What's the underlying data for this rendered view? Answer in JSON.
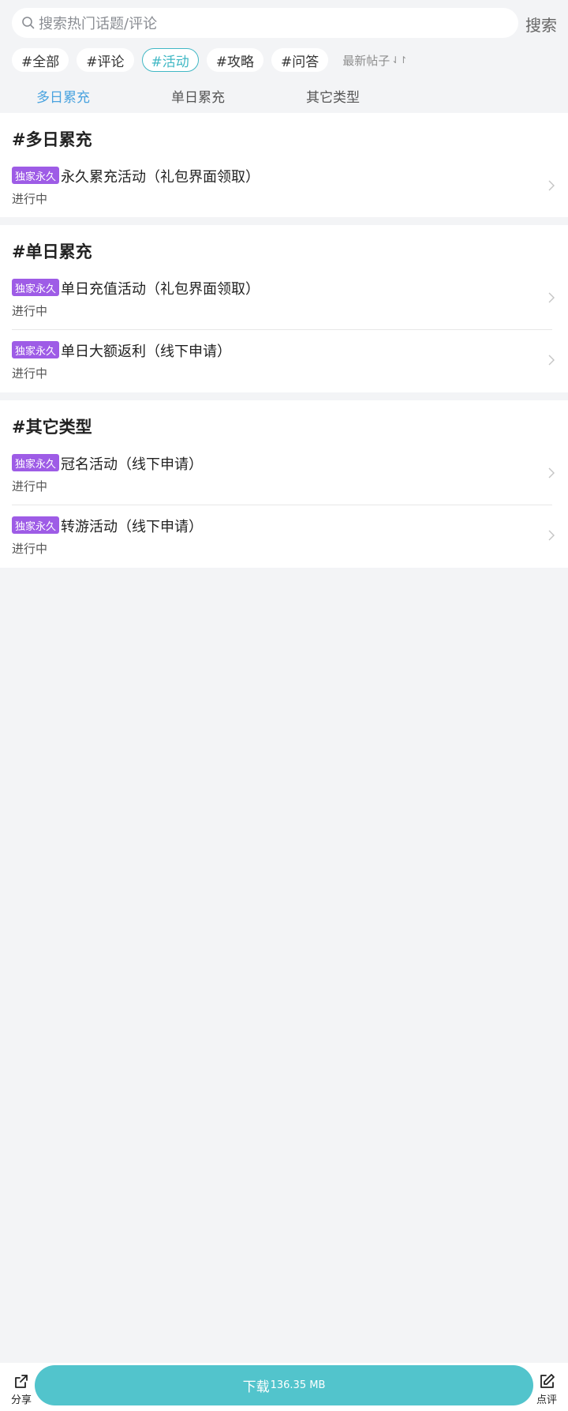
{
  "search": {
    "placeholder": "搜索热门话题/评论",
    "button_label": "搜索"
  },
  "tags": [
    {
      "label": "#全部",
      "active": false
    },
    {
      "label": "#评论",
      "active": false
    },
    {
      "label": "#活动",
      "active": true
    },
    {
      "label": "#攻略",
      "active": false
    },
    {
      "label": "#问答",
      "active": false
    }
  ],
  "sort": {
    "label": "最新帖子",
    "icon": "sort-arrows-icon"
  },
  "category_tabs": [
    {
      "label": "多日累充",
      "active": true
    },
    {
      "label": "单日累充",
      "active": false
    },
    {
      "label": "其它类型",
      "active": false
    }
  ],
  "sections": [
    {
      "title": "#多日累充",
      "items": [
        {
          "badge": "独家永久",
          "title": "永久累充活动（礼包界面领取）",
          "status": "进行中"
        }
      ]
    },
    {
      "title": "#单日累充",
      "items": [
        {
          "badge": "独家永久",
          "title": "单日充值活动（礼包界面领取）",
          "status": "进行中"
        },
        {
          "badge": "独家永久",
          "title": "单日大额返利（线下申请）",
          "status": "进行中"
        }
      ]
    },
    {
      "title": "#其它类型",
      "items": [
        {
          "badge": "独家永久",
          "title": "冠名活动（线下申请）",
          "status": "进行中"
        },
        {
          "badge": "独家永久",
          "title": "转游活动（线下申请）",
          "status": "进行中"
        }
      ]
    }
  ],
  "bottom_bar": {
    "share_label": "分享",
    "download_label": "下载",
    "download_size": "136.35 MB",
    "review_label": "点评"
  },
  "colors": {
    "accent": "#41b8c5",
    "tab_active": "#4aa3df",
    "badge": "#9e5ce6",
    "download_button": "#52c4cc",
    "background": "#f3f4f6"
  }
}
